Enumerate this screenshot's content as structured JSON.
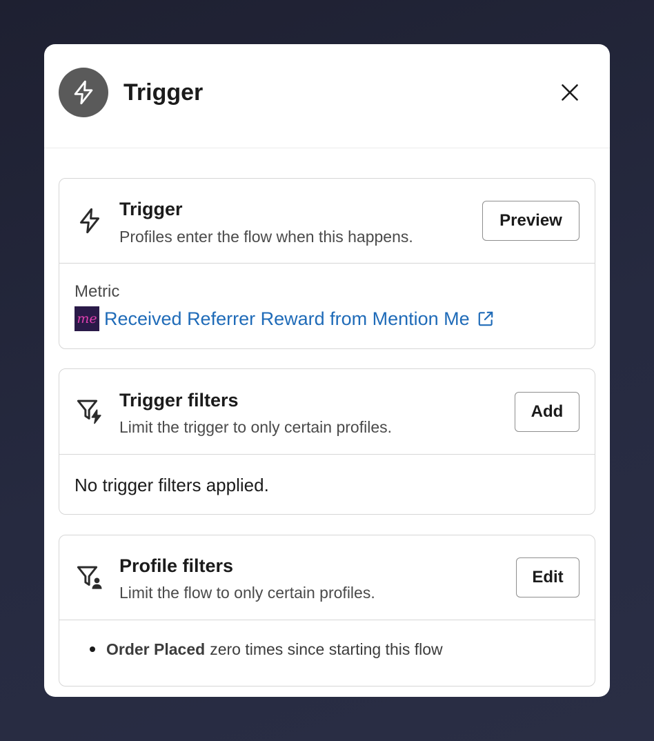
{
  "header": {
    "title": "Trigger",
    "icon": "lightning-icon",
    "close_icon": "close-icon"
  },
  "trigger_card": {
    "title": "Trigger",
    "subtitle": "Profiles enter the flow when this happens.",
    "button_label": "Preview",
    "metric_label": "Metric",
    "metric_logo_text": "me",
    "metric_name": "Received Referrer Reward from Mention Me",
    "metric_icon": "external-link-icon"
  },
  "trigger_filters_card": {
    "title": "Trigger filters",
    "subtitle": "Limit the trigger to only certain profiles.",
    "button_label": "Add",
    "empty_text": "No trigger filters applied."
  },
  "profile_filters_card": {
    "title": "Profile filters",
    "subtitle": "Limit the flow to only certain profiles.",
    "button_label": "Edit",
    "filters": [
      {
        "metric": "Order Placed",
        "condition": "zero times since starting this flow"
      }
    ]
  },
  "colors": {
    "backdrop": "#23263a",
    "header_icon_bg": "#5a5a5a",
    "link": "#1f6bb8",
    "logo_bg": "#2a1a48",
    "logo_text": "#e040b0"
  }
}
